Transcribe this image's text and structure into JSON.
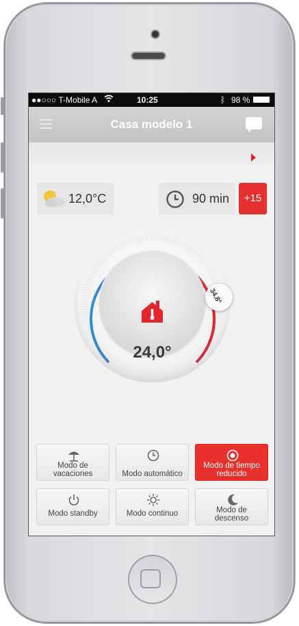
{
  "status_bar": {
    "carrier": "●●○○○ T-Mobile A",
    "wifi_icon": "wifi-icon",
    "time": "10:25",
    "bluetooth_icon": "bluetooth-icon",
    "battery": "98 %"
  },
  "header": {
    "title": "Casa modelo 1",
    "menu_icon": "menu-icon",
    "chat_icon": "chat-icon"
  },
  "info": {
    "outdoor_temp": "12,0°C",
    "timer_value": "90 min",
    "plus_label": "+15"
  },
  "dial": {
    "current_temp": "24,0°",
    "setpoint_badge": "34,8°",
    "icon": "house-thermometer-icon"
  },
  "modes": [
    {
      "label": "Modo de vacaciones",
      "icon": "umbrella-icon",
      "active": false
    },
    {
      "label": "Modo automático",
      "icon": "clock-icon",
      "active": false
    },
    {
      "label": "Modo de tiempo reducido",
      "icon": "target-icon",
      "active": true
    },
    {
      "label": "Modo standby",
      "icon": "power-icon",
      "active": false
    },
    {
      "label": "Modo continuo",
      "icon": "sun-icon",
      "active": false
    },
    {
      "label": "Modo de descenso",
      "icon": "moon-icon",
      "active": false
    }
  ],
  "colors": {
    "accent": "#e8302c",
    "dial_cold": "#2d8fd6",
    "dial_hot": "#e3252b"
  }
}
